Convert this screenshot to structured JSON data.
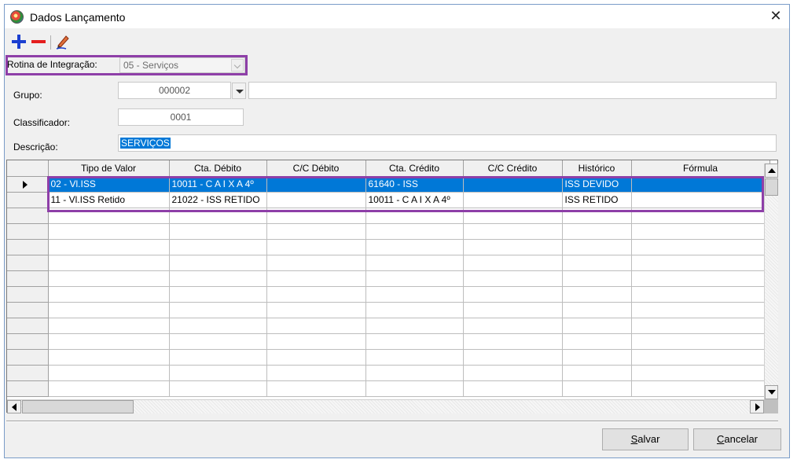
{
  "window": {
    "title": "Dados Lançamento",
    "close_glyph": "✕",
    "icon": "app-globe-icon"
  },
  "toolbar": {
    "add_icon": "plus-icon",
    "remove_icon": "minus-icon",
    "edit_icon": "pencil-icon",
    "colors": {
      "add": "#1b3fd0",
      "remove": "#e41e1e"
    }
  },
  "form": {
    "rotina_label": "Rotina de Integração:",
    "rotina_value": "05 - Serviços",
    "grupo_label": "Grupo:",
    "grupo_value": "000002",
    "grupo_desc": "",
    "classificador_label": "Classificador:",
    "classificador_value": "0001",
    "descricao_label": "Descrição:",
    "descricao_value": "SERVIÇOS"
  },
  "grid": {
    "columns": [
      "Tipo de Valor",
      "Cta. Débito",
      "C/C Débito",
      "Cta. Crédito",
      "C/C Crédito",
      "Histórico",
      "Fórmula"
    ],
    "rows": [
      [
        "02 - Vl.ISS",
        "10011 - C A I X A 4º",
        "",
        "61640 - ISS",
        "",
        "ISS DEVIDO",
        ""
      ],
      [
        "11 - Vl.ISS Retido",
        "21022 - ISS RETIDO",
        "",
        "10011 - C A I X A 4º",
        "",
        "ISS RETIDO",
        ""
      ]
    ],
    "selected_row": 0,
    "highlight_color": "#8e3fa8",
    "selection_color": "#0078d7"
  },
  "buttons": {
    "salvar_first": "S",
    "salvar_rest": "alvar",
    "cancelar_first": "C",
    "cancelar_rest": "ancelar"
  }
}
